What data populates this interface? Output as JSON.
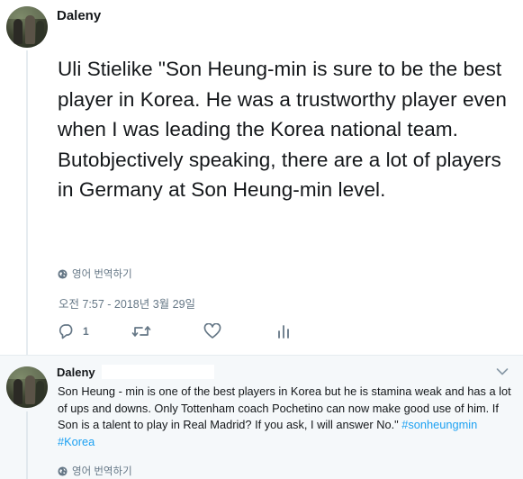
{
  "main_tweet": {
    "author": "Daleny",
    "text": "Uli Stielike \"Son Heung-min is sure to be the best player in Korea. He was a trustworthy player even when I was leading the Korea national team. Butobjectively speaking, there are a lot of players in Germany at Son Heung-min level.",
    "translate_label": "영어 번역하기",
    "timestamp": "오전 7:57 - 2018년 3월 29일",
    "reply_count": "1",
    "icons": [
      "globe-icon",
      "reply-icon",
      "retweet-icon",
      "heart-icon",
      "analytics-icon"
    ]
  },
  "reply_tweet": {
    "author": "Daleny",
    "text": "Son Heung - min is one of the best players in Korea but he is stamina weak and has a lot of ups and downs. Only Tottenham coach Pochetino can now make good use of him. If Son is a talent to play in Real Madrid? If you ask, I will answer No.\" ",
    "hashtags": [
      "#sonheungmin",
      "#Korea"
    ],
    "translate_label": "영어 번역하기",
    "icons": [
      "chevron-down-icon",
      "globe-icon"
    ]
  },
  "colors": {
    "text": "#14171a",
    "secondary": "#657786",
    "link": "#1da1f2",
    "reply_background": "#f5f8fa",
    "divider": "#e6ecf0"
  }
}
